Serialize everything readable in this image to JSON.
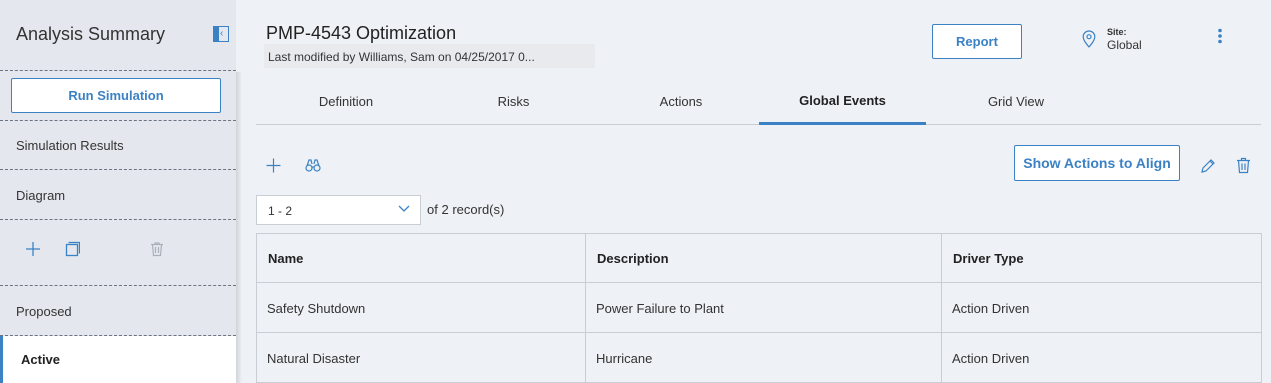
{
  "sidebar": {
    "title": "Analysis Summary",
    "run_button": "Run Simulation",
    "items": [
      {
        "label": "Simulation Results"
      },
      {
        "label": "Diagram"
      }
    ],
    "icons": [
      "plus-icon",
      "copy-icon",
      "trash-icon"
    ],
    "sections": [
      {
        "label": "Proposed"
      },
      {
        "label": "Active"
      }
    ]
  },
  "header": {
    "title": "PMP-4543 Optimization",
    "subtitle": "Last modified by Williams, Sam on 04/25/2017 0...",
    "report_button": "Report",
    "site_label": "Site:",
    "site_value": "Global"
  },
  "tabs": [
    {
      "label": "Definition"
    },
    {
      "label": "Risks"
    },
    {
      "label": "Actions"
    },
    {
      "label": "Global Events",
      "active": true
    },
    {
      "label": "Grid View"
    }
  ],
  "toolbar": {
    "align_button": "Show Actions to Align"
  },
  "pager": {
    "range": "1 - 2",
    "of": "of",
    "total": "2",
    "unit": "record(s)"
  },
  "table": {
    "columns": [
      "Name",
      "Description",
      "Driver Type"
    ],
    "rows": [
      [
        "Safety Shutdown",
        "Power Failure to Plant",
        "Action Driven"
      ],
      [
        "Natural Disaster",
        "Hurricane",
        "Action Driven"
      ]
    ]
  },
  "colors": {
    "accent": "#3b82c4",
    "sidebar_bg": "#e4e8ee",
    "page_bg": "#eef1f5"
  }
}
